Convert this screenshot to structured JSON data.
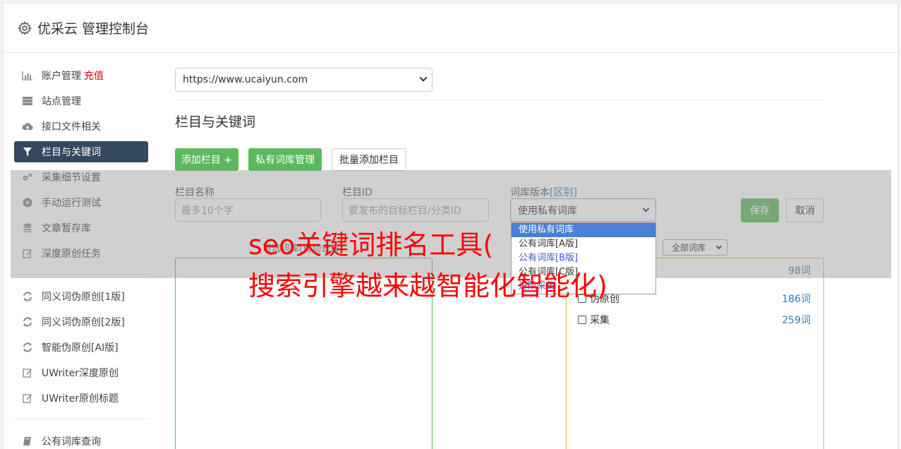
{
  "header": {
    "title": "优采云 管理控制台"
  },
  "sidebar": {
    "items": [
      {
        "label": "账户管理",
        "extra": "充值",
        "icon": "bar-chart-icon"
      },
      {
        "label": "站点管理",
        "icon": "server-icon"
      },
      {
        "label": "接口文件相关",
        "icon": "cloud-upload-icon"
      },
      {
        "label": "栏目与关键词",
        "icon": "filter-icon",
        "active": true
      },
      {
        "label": "采集细节设置",
        "icon": "gears-icon"
      },
      {
        "label": "手动运行测试",
        "icon": "play-circle-icon"
      },
      {
        "label": "文章暂存库",
        "icon": "database-icon"
      },
      {
        "label": "深度原创任务",
        "icon": "edit-icon"
      }
    ],
    "items2": [
      {
        "label": "同义词伪原创[1版]",
        "icon": "refresh-icon"
      },
      {
        "label": "同义词伪原创[2版]",
        "icon": "refresh-icon"
      },
      {
        "label": "智能伪原创[AI版]",
        "icon": "refresh-icon"
      },
      {
        "label": "UWriter深度原创",
        "icon": "edit-icon"
      },
      {
        "label": "UWriter原创标题",
        "icon": "edit-icon"
      }
    ],
    "items3": [
      {
        "label": "公有词库查询",
        "icon": "book-icon"
      }
    ]
  },
  "main": {
    "site_select": "https://www.ucaiyun.com",
    "section_title": "栏目与关键词",
    "buttons": {
      "add_column": "添加栏目 +",
      "private_lib": "私有词库管理",
      "batch_add": "批量添加栏目",
      "save": "保存",
      "cancel": "取消"
    },
    "form": {
      "name_label": "栏目名称",
      "name_placeholder": "最多10个字",
      "id_label": "栏目ID",
      "id_placeholder": "要发布的目标栏目/分类ID",
      "lib_label": "词库版本",
      "lib_label_link": "[区别]",
      "lib_selected": "使用私有词库",
      "lib_options": [
        "使用私有词库",
        "公有词库[A版]",
        "公有词库[B版]",
        "公有词库[C版]",
        "进阶采集"
      ]
    },
    "hidden_label": "可选词库(自动去重)",
    "filter_select": "全部词库",
    "libraries": [
      {
        "name": "",
        "count": "98词"
      },
      {
        "name": "伪原创",
        "count": "186词"
      },
      {
        "name": "采集",
        "count": "259词"
      }
    ]
  },
  "watermark": {
    "line1": "seo关键词排名工具(",
    "line2": "搜索引擎越来越智能化智能化)"
  },
  "colors": {
    "green": "#5cb85c",
    "active_nav": "#34495e",
    "accent_red": "#e60012",
    "watermark": "#ff0000"
  }
}
